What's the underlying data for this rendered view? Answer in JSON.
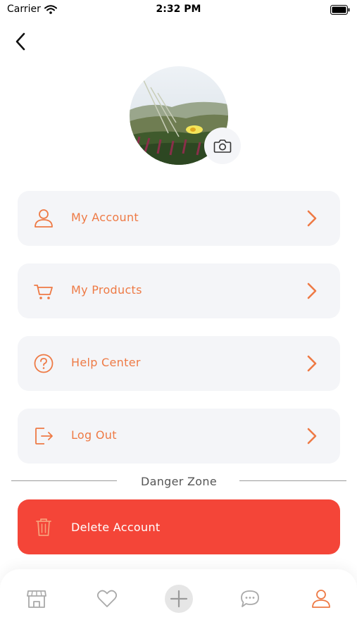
{
  "status_bar": {
    "carrier": "Carrier",
    "time": "2:32 PM"
  },
  "menu": [
    {
      "label": "My Account",
      "icon": "user-icon"
    },
    {
      "label": "My Products",
      "icon": "cart-icon"
    },
    {
      "label": "Help Center",
      "icon": "help-icon"
    },
    {
      "label": "Log Out",
      "icon": "logout-icon"
    }
  ],
  "danger_zone": {
    "title": "Danger Zone",
    "delete_label": "Delete Account"
  },
  "tab_bar": [
    "store-icon",
    "heart-icon",
    "add-icon",
    "chat-icon",
    "profile-icon"
  ],
  "colors": {
    "accent": "#ee7a45",
    "danger": "#f44538",
    "card": "#f4f5f8",
    "tab_inactive": "#a9a9a9"
  }
}
